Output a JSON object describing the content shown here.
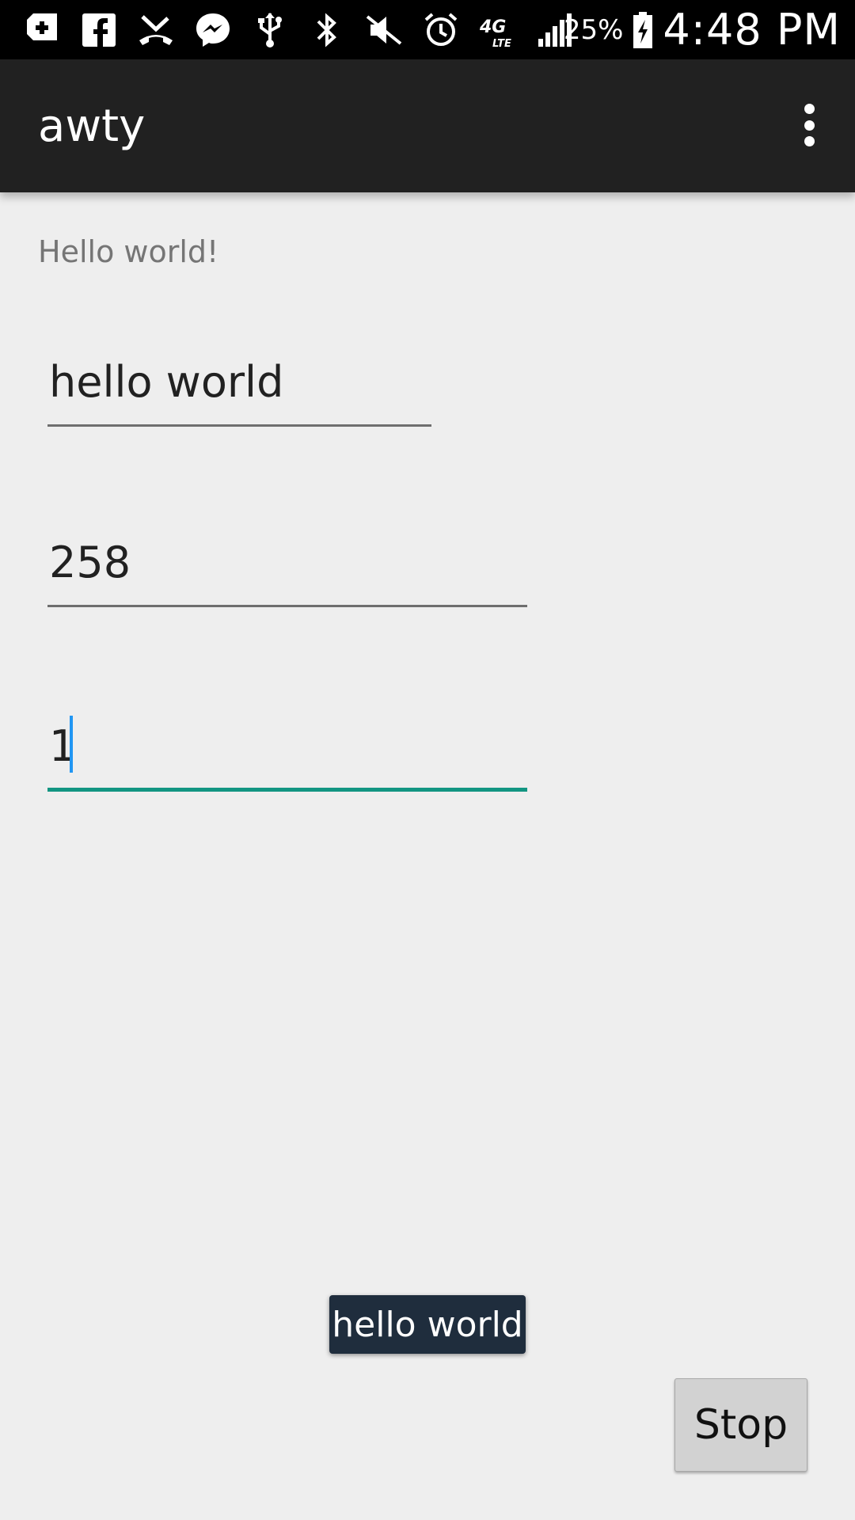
{
  "status_bar": {
    "icons": [
      "plus-box-icon",
      "facebook-icon",
      "missed-call-icon",
      "messenger-icon",
      "usb-icon",
      "bluetooth-icon",
      "mute-icon",
      "alarm-icon",
      "network-4g-lte-icon",
      "signal-icon",
      "battery-charging-icon"
    ],
    "battery": "25%",
    "time": "4:48 PM"
  },
  "app_bar": {
    "title": "awty",
    "menu_icon": "overflow-menu-icon"
  },
  "main": {
    "greeting": "Hello world!",
    "message_field": {
      "value": "hello world"
    },
    "phone_field": {
      "value": "258"
    },
    "interval_field": {
      "value": "1"
    }
  },
  "toast": {
    "text": "hello world"
  },
  "stop_button": {
    "label": "Stop"
  },
  "colors": {
    "app_bar": "#212121",
    "background": "#eeeeee",
    "accent": "#129582",
    "cursor": "#2196f3",
    "toast": "#1f2d3d"
  }
}
